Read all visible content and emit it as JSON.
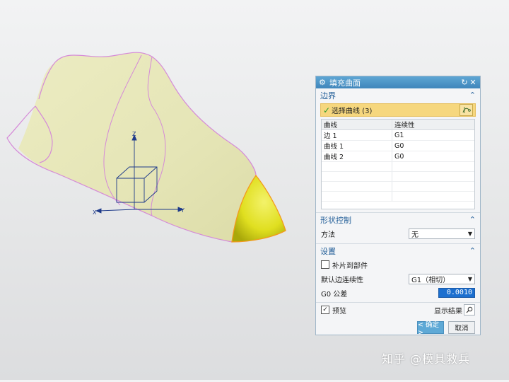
{
  "viewport": {
    "axis_labels": {
      "z": "Z",
      "y": "Y",
      "x": "X"
    },
    "colors": {
      "surface": "#e7e7b9",
      "edge": "#d58ad8",
      "patch": "#e1e02a",
      "patch_edge": "#f39a1c",
      "axis": "#1e3a8a"
    }
  },
  "dialog": {
    "title": "填充曲面",
    "title_icon": "gear-icon",
    "reset_icon": "reset-icon",
    "close_icon": "close-icon",
    "boundary": {
      "header": "边界",
      "select_label": "选择曲线 (3)",
      "table": {
        "columns": [
          "曲线",
          "连续性"
        ],
        "rows": [
          {
            "curve": "边 1",
            "continuity": "G1"
          },
          {
            "curve": "曲线 1",
            "continuity": "G0"
          },
          {
            "curve": "曲线 2",
            "continuity": "G0"
          }
        ]
      }
    },
    "shape_control": {
      "header": "形状控制",
      "method_label": "方法",
      "method_value": "无"
    },
    "settings": {
      "header": "设置",
      "patch_to_part_label": "补片到部件",
      "default_continuity_label": "默认边连续性",
      "default_continuity_value": "G1（相切）",
      "g0_tolerance_label": "G0 公差",
      "g0_tolerance_value": "0.0010"
    },
    "preview_label": "预览",
    "show_result_label": "显示结果",
    "ok_label": "< 确定 >",
    "cancel_label": "取消",
    "colors": {
      "title_bar": "#4b94c6",
      "section_text": "#1f5c97",
      "selection_bg": "#f6d77e",
      "tolerance_bg": "#1c6fcf"
    }
  },
  "watermark": "知乎 @模具救兵"
}
